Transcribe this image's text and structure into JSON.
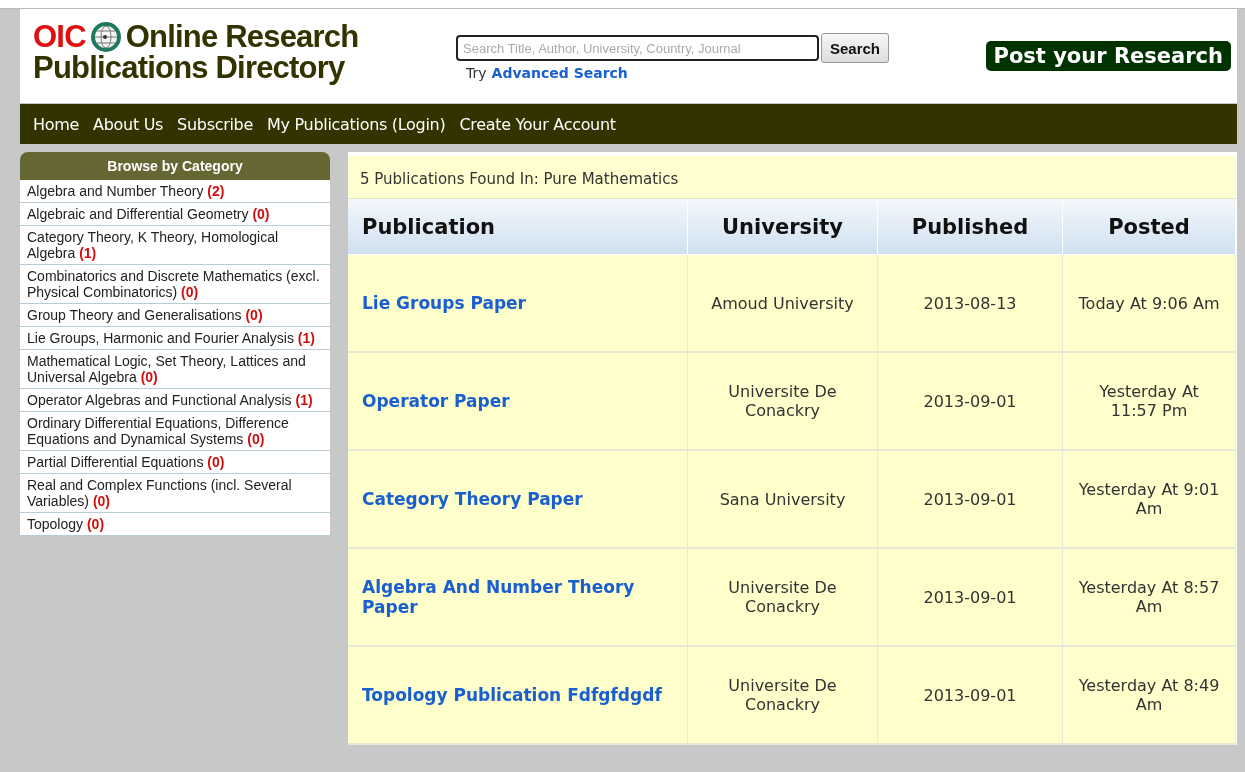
{
  "header": {
    "logo_mark": "OIC",
    "title_line_1": "Online Research",
    "title_line_2": "Publications Directory",
    "search": {
      "placeholder": "Search Title, Author, University, Country, Journal",
      "button": "Search",
      "hint": "Try",
      "advanced_link": "Advanced Search"
    },
    "post_button": "Post your Research"
  },
  "nav": [
    "Home",
    "About Us",
    "Subscribe",
    "My Publications (Login)",
    "Create Your Account"
  ],
  "sidebar": {
    "title": "Browse by Category",
    "items": [
      {
        "label": "Algebra and Number Theory",
        "count": "(2)"
      },
      {
        "label": "Algebraic and Differential Geometry",
        "count": "(0)"
      },
      {
        "label": "Category Theory, K Theory, Homological Algebra",
        "count": "(1)"
      },
      {
        "label": "Combinatorics and Discrete Mathematics (excl. Physical Combinatorics)",
        "count": "(0)"
      },
      {
        "label": "Group Theory and Generalisations",
        "count": "(0)"
      },
      {
        "label": "Lie Groups, Harmonic and Fourier Analysis",
        "count": "(1)"
      },
      {
        "label": "Mathematical Logic, Set Theory, Lattices and Universal Algebra",
        "count": "(0)"
      },
      {
        "label": "Operator Algebras and Functional Analysis",
        "count": "(1)"
      },
      {
        "label": "Ordinary Differential Equations, Difference Equations and Dynamical Systems",
        "count": "(0)"
      },
      {
        "label": "Partial Differential Equations",
        "count": "(0)"
      },
      {
        "label": "Real and Complex Functions (incl. Several Variables)",
        "count": "(0)"
      },
      {
        "label": "Topology",
        "count": "(0)"
      }
    ]
  },
  "results": {
    "summary": "5 Publications Found In: Pure Mathematics",
    "table": {
      "columns": [
        "Publication",
        "University",
        "Published",
        "Posted"
      ],
      "rows": [
        [
          "Lie Groups Paper",
          "Amoud University",
          "2013-08-13",
          "Today At 9:06 Am"
        ],
        [
          "Operator Paper",
          "Universite De Conackry",
          "2013-09-01",
          "Yesterday At 11:57 Pm"
        ],
        [
          "Category Theory Paper",
          "Sana University",
          "2013-09-01",
          "Yesterday At 9:01 Am"
        ],
        [
          "Algebra And Number Theory Paper",
          "Universite De Conackry",
          "2013-09-01",
          "Yesterday At 8:57 Am"
        ],
        [
          "Topology Publication Fdfgfdgdf",
          "Universite De Conackry",
          "2013-09-01",
          "Yesterday At 8:49 Am"
        ]
      ]
    }
  }
}
